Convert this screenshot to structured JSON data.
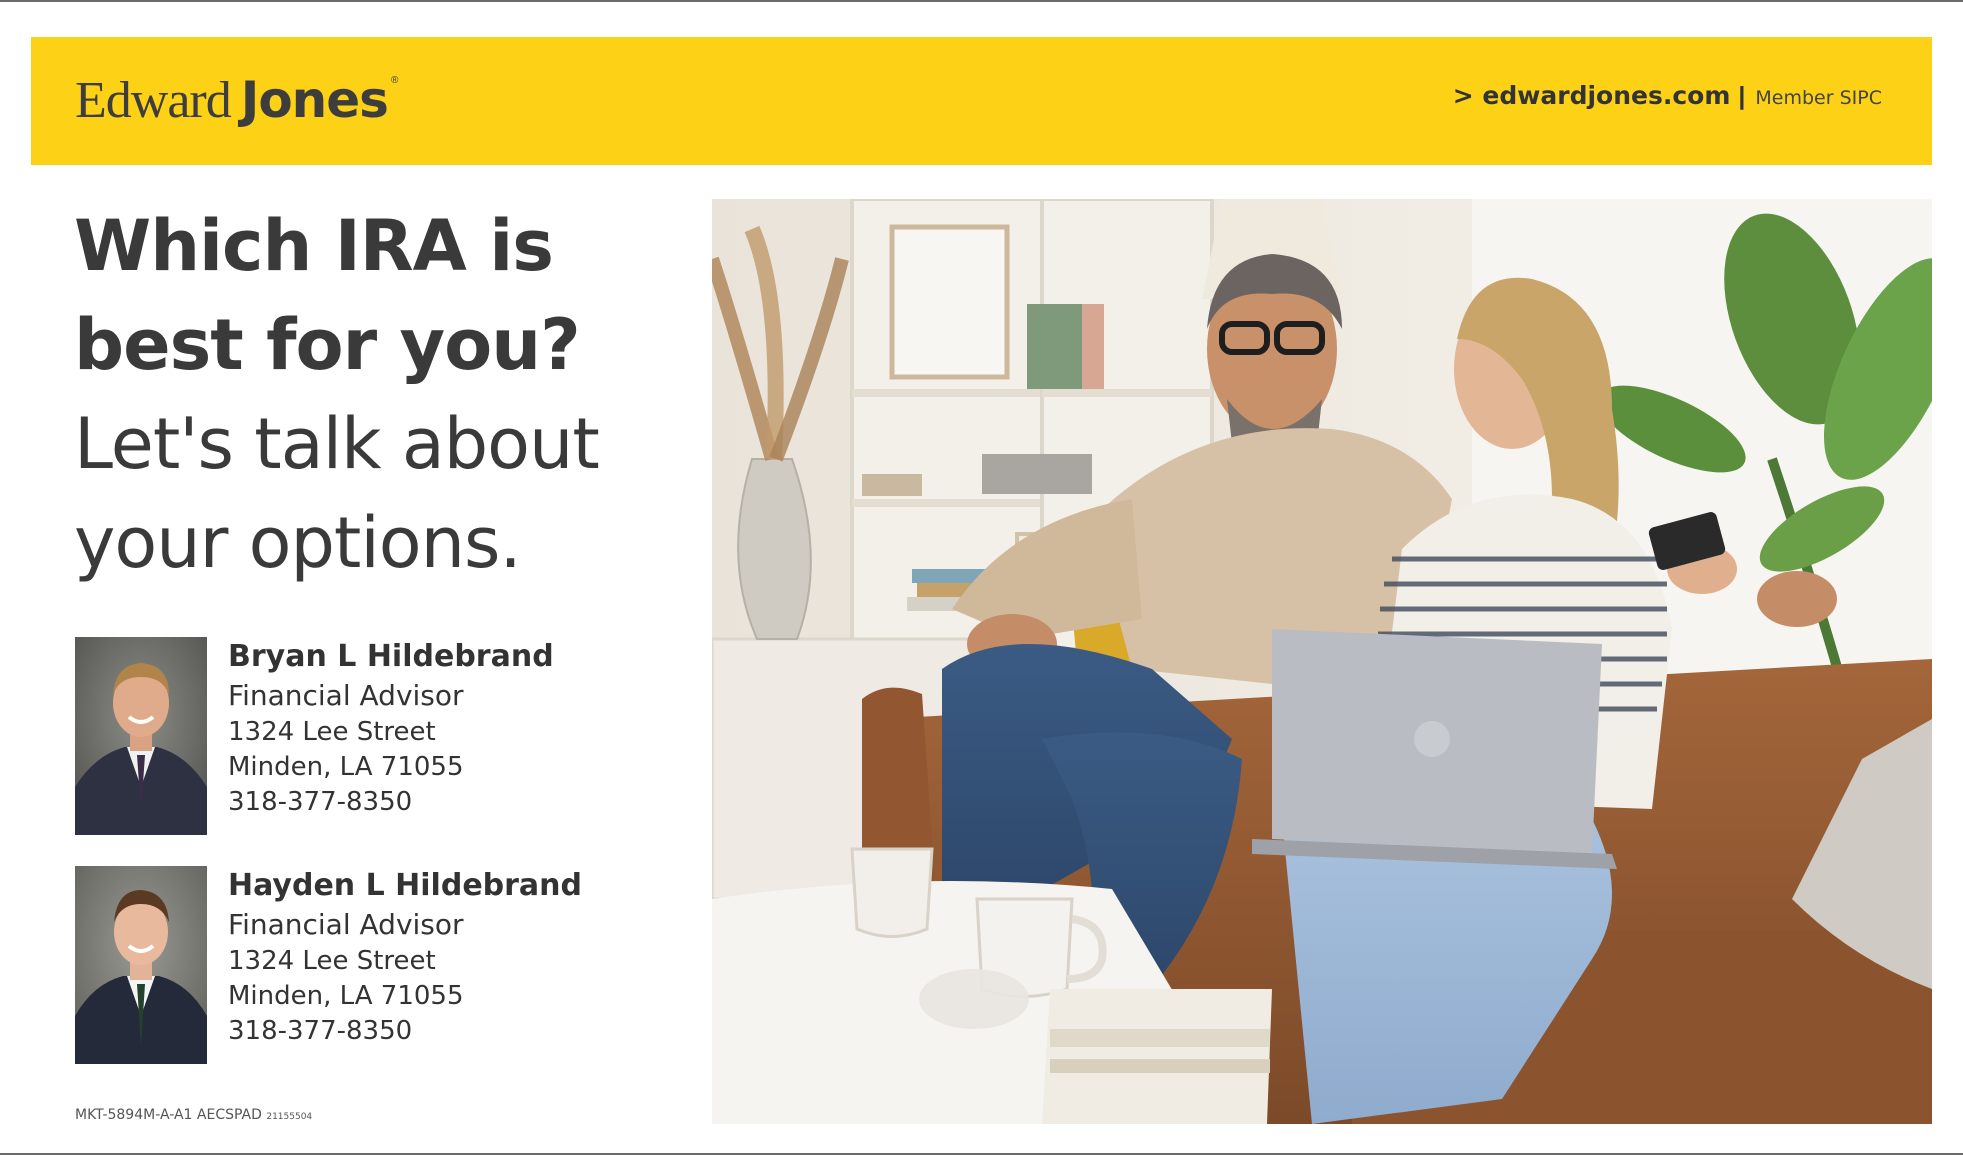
{
  "brand": {
    "logo_word_1": "Edward",
    "logo_word_2": "Jones",
    "logo_mark": "®",
    "colors": {
      "banner": "#fcd116",
      "text": "#3a3a3a"
    }
  },
  "banner": {
    "site": "> edwardjones.com",
    "separator": "|",
    "member": "Member SIPC"
  },
  "headline": {
    "line1": "Which IRA is",
    "line2": "best for you?",
    "line3": "Let's talk about",
    "line4": "your options."
  },
  "advisors": [
    {
      "name": "Bryan L Hildebrand",
      "title": "Financial Advisor",
      "street": "1324 Lee Street",
      "city": "Minden, LA 71055",
      "phone": "318-377-8350"
    },
    {
      "name": "Hayden L Hildebrand",
      "title": "Financial Advisor",
      "street": "1324 Lee Street",
      "city": "Minden, LA 71055",
      "phone": "318-377-8350"
    }
  ],
  "footer": {
    "code": "MKT-5894M-A-A1 AECSPAD",
    "code_small": "21155504"
  }
}
